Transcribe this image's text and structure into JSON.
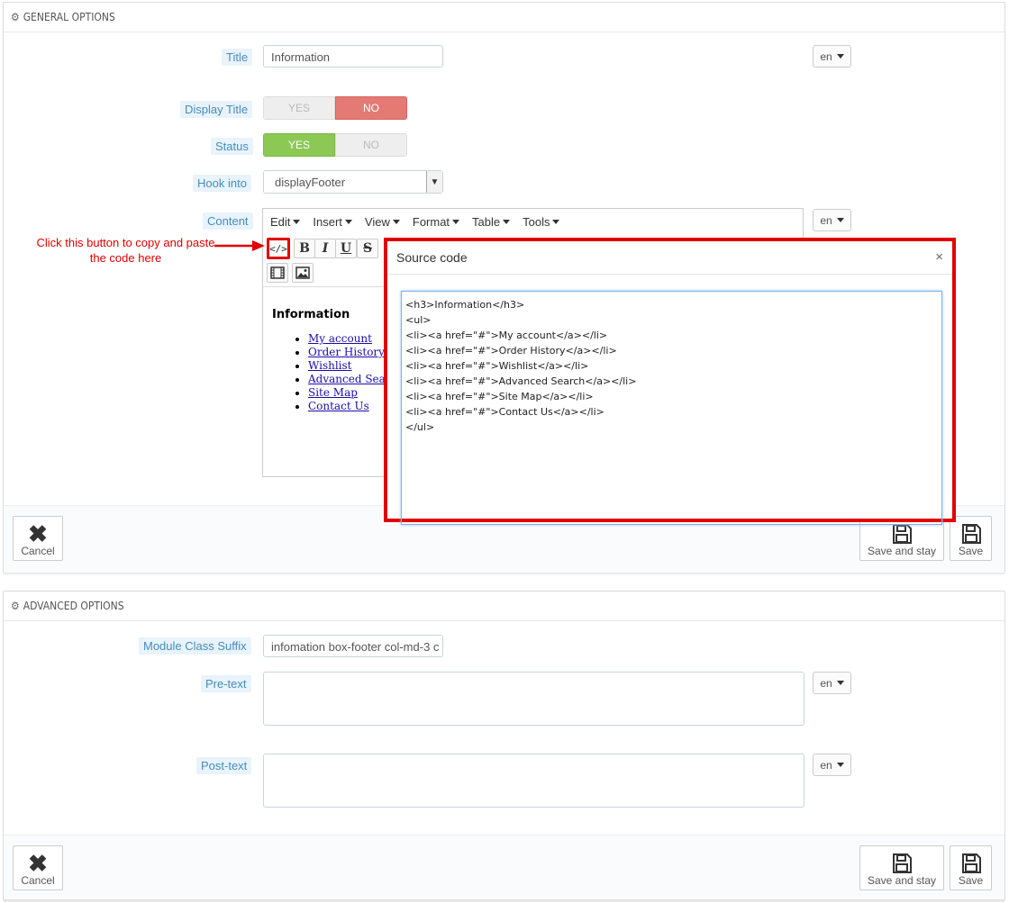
{
  "general": {
    "heading": "GENERAL OPTIONS",
    "title_label": "Title",
    "title_value": "Information",
    "lang": "en",
    "display_title_label": "Display Title",
    "status_label": "Status",
    "yes": "YES",
    "no": "NO",
    "hook_label": "Hook into",
    "hook_value": "displayFooter",
    "content_label": "Content"
  },
  "editor": {
    "menu": [
      "Edit",
      "Insert",
      "View",
      "Format",
      "Table",
      "Tools"
    ],
    "bold": "B",
    "italic": "I",
    "underline": "U",
    "strike": "S",
    "source_icon_label": "</>",
    "heading": "Information",
    "links": [
      "My account",
      "Order History",
      "Wishlist",
      "Advanced Sea",
      "Site Map",
      "Contact Us"
    ]
  },
  "annotation": "Click this button to copy and paste the code here",
  "modal": {
    "title": "Source code",
    "close": "×",
    "code": "<h3>Information</h3>\n<ul>\n<li><a href=\"#\">My account</a></li>\n<li><a href=\"#\">Order History</a></li>\n<li><a href=\"#\">Wishlist</a></li>\n<li><a href=\"#\">Advanced Search</a></li>\n<li><a href=\"#\">Site Map</a></li>\n<li><a href=\"#\">Contact Us</a></li>\n</ul>"
  },
  "actions": {
    "cancel": "Cancel",
    "save_and_stay": "Save and stay",
    "save": "Save"
  },
  "advanced": {
    "heading": "ADVANCED OPTIONS",
    "suffix_label": "Module Class Suffix",
    "suffix_value": "infomation box-footer col-md-3 c",
    "pretext_label": "Pre-text",
    "posttext_label": "Post-text",
    "lang": "en"
  },
  "colors": {
    "accent_blue": "#468dbc",
    "yes_green": "#8bc954",
    "no_red": "#e57a74",
    "annotation_red": "#e00000"
  }
}
